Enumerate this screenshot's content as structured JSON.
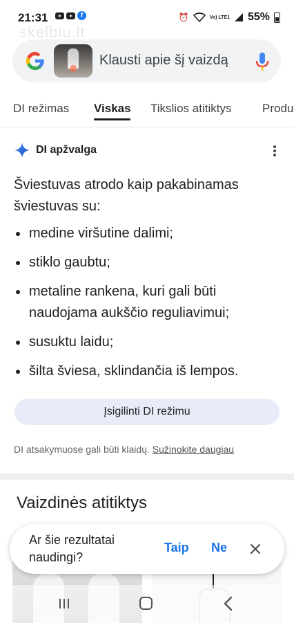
{
  "status_bar": {
    "time": "21:31",
    "battery": "55%",
    "network_label": "Vo) LTE1"
  },
  "watermark": "skelbiu.lt",
  "search": {
    "query_text": "Klausti apie šį vaizdą"
  },
  "tabs": [
    {
      "label": "DI režimas"
    },
    {
      "label": "Viskas",
      "active": true
    },
    {
      "label": "Tikslios atitiktys"
    },
    {
      "label": "Produ"
    }
  ],
  "ai_overview": {
    "title": "DI apžvalga",
    "intro": "Šviestuvas atrodo kaip pakabinamas šviestuvas su:",
    "items": [
      "medine viršutine dalimi;",
      "stiklo gaubtu;",
      "metaline rankena, kuri gali būti naudojama aukščio reguliavimui;",
      "susuktu laidu;",
      "šilta šviesa, sklindančia iš lempos."
    ],
    "button_label": "Įsigilinti DI režimu",
    "disclaimer": "DI atsakymuose gali būti klaidų.",
    "learn_more": "Sužinokite daugiau"
  },
  "visual_matches": {
    "title": "Vaizdinės atitiktys"
  },
  "feedback": {
    "question": "Ar šie rezultatai naudingi?",
    "yes_label": "Taip",
    "no_label": "Ne"
  },
  "colors": {
    "accent_blue": "#1a73e8",
    "ai_button_bg": "#e8ecf9",
    "search_bg": "#f1f3f4"
  }
}
